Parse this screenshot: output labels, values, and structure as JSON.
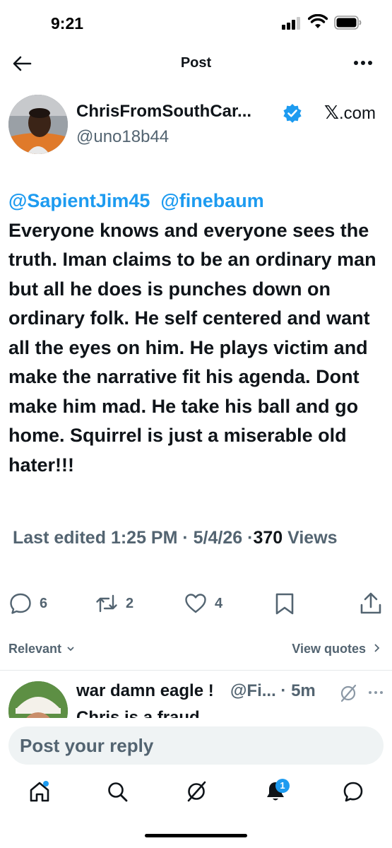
{
  "status_bar": {
    "time": "9:21",
    "signal_icon": "cellular-signal-icon",
    "wifi_icon": "wifi-icon",
    "battery_icon": "battery-icon"
  },
  "header": {
    "title": "Post",
    "back_icon": "back-arrow-icon",
    "more_icon": "more-horizontal-icon"
  },
  "author": {
    "display_name": "ChrisFromSouthCar...",
    "handle": "@uno18b44",
    "verified": true,
    "source_mark": "𝕏",
    "source_text": ".com"
  },
  "tweet": {
    "mention_1": "@SapientJim45",
    "mention_2": "@finebaum",
    "body": "Everyone knows and everyone sees the truth. Iman claims to be an ordinary man but all he does is punches down on ordinary folk. He self centered and want all the eyes on him. He plays victim and make the narrative fit his agenda. Dont make him mad. He take his ball and go home. Squirrel is just a miserable old  hater!!!"
  },
  "meta": {
    "edited_prefix": "Last edited",
    "time": "1:25 PM",
    "separator": "·",
    "date": "5/4/26",
    "views_count": "370",
    "views_label": "Views"
  },
  "actions": {
    "replies": "6",
    "reposts": "2",
    "likes": "4"
  },
  "sort": {
    "relevant_label": "Relevant",
    "view_quotes_label": "View quotes"
  },
  "reply_preview": {
    "display_name": "war damn eagle !",
    "meta": "@Fi... · 5m",
    "text": "Chris is a fraud"
  },
  "reply_box": {
    "placeholder": "Post your reply"
  },
  "bottom_nav": {
    "notifications_badge": "1"
  },
  "colors": {
    "accent": "#1d9bf0",
    "text": "#0f1419",
    "secondary": "#536471"
  }
}
